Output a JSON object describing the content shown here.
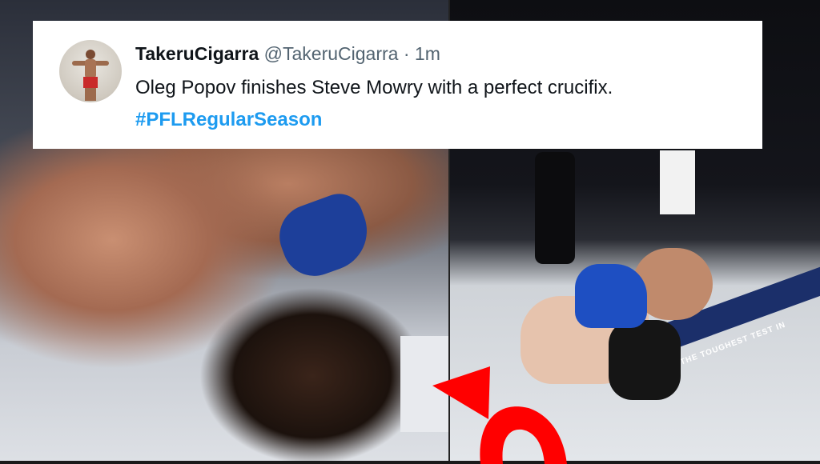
{
  "tweet": {
    "display_name": "TakeruCigarra",
    "handle": "@TakeruCigarra",
    "separator": "·",
    "time": "1m",
    "text": "Oleg Popov finishes Steve Mowry with a perfect crucifix.",
    "hashtag": "#PFLRegularSeason"
  },
  "scene": {
    "mat_text": "THE TOUGHEST TEST IN",
    "arrow_color": "#ff0000"
  }
}
